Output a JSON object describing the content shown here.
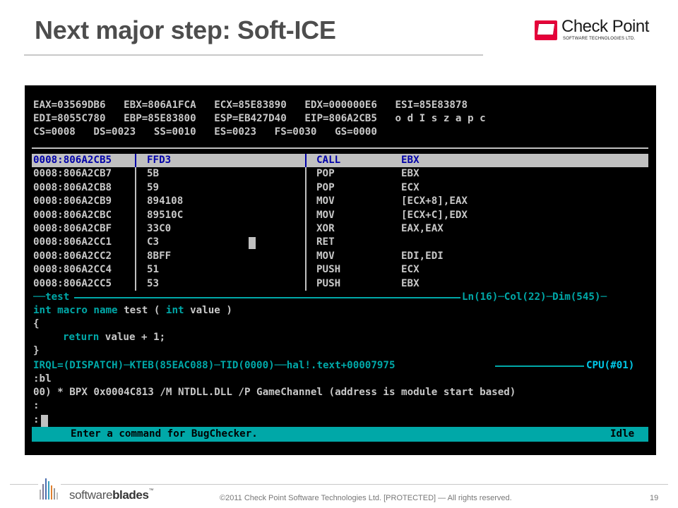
{
  "slide": {
    "title": "Next major step: Soft-ICE",
    "logo_main": "Check Point",
    "logo_sub": "SOFTWARE TECHNOLOGIES LTD.",
    "logo_badge": "CP"
  },
  "softice": {
    "registers": [
      "EAX=03569DB6   EBX=806A1FCA   ECX=85E83890   EDX=000000E6   ESI=85E83878",
      "EDI=8055C780   EBP=85E83800   ESP=EB427D40   EIP=806A2CB5   o d I s z a p c",
      "CS=0008   DS=0023   SS=0010   ES=0023   FS=0030   GS=0000"
    ],
    "code": [
      {
        "addr": "0008:806A2CB5",
        "bytes": "FFD3",
        "mnemonic": "CALL",
        "operand": "EBX"
      },
      {
        "addr": "0008:806A2CB7",
        "bytes": "5B",
        "mnemonic": "POP",
        "operand": "EBX"
      },
      {
        "addr": "0008:806A2CB8",
        "bytes": "59",
        "mnemonic": "POP",
        "operand": "ECX"
      },
      {
        "addr": "0008:806A2CB9",
        "bytes": "894108",
        "mnemonic": "MOV",
        "operand": "[ECX+8],EAX"
      },
      {
        "addr": "0008:806A2CBC",
        "bytes": "89510C",
        "mnemonic": "MOV",
        "operand": "[ECX+C],EDX"
      },
      {
        "addr": "0008:806A2CBF",
        "bytes": "33C0",
        "mnemonic": "XOR",
        "operand": "EAX,EAX"
      },
      {
        "addr": "0008:806A2CC1",
        "bytes": "C3",
        "mnemonic": "RET",
        "operand": ""
      },
      {
        "addr": "0008:806A2CC2",
        "bytes": "8BFF",
        "mnemonic": "MOV",
        "operand": "EDI,EDI"
      },
      {
        "addr": "0008:806A2CC4",
        "bytes": "51",
        "mnemonic": "PUSH",
        "operand": "ECX"
      },
      {
        "addr": "0008:806A2CC5",
        "bytes": "53",
        "mnemonic": "PUSH",
        "operand": "EBX"
      }
    ],
    "macro_header_left": "──test",
    "macro_header_right": "Ln(16)─Col(22)─Dim(545)─",
    "macro_sig": {
      "t1": "int",
      "t2": " macro name ",
      "t3": "test ( ",
      "t4": "int",
      "t5": " value )"
    },
    "macro_open": "{",
    "macro_ret_kw": "return",
    "macro_ret_rest": " value + 1;",
    "macro_close": "}",
    "irql_left": "IRQL=(DISPATCH)─KTEB(85EAC088)─TID(0000)──hal!.text+00007975",
    "irql_right": "CPU(#01)",
    "cmd_lines": [
      ":bl",
      "00) * BPX 0x0004C813 /M NTDLL.DLL /P GameChannel (address is module start based)",
      ":",
      ":"
    ],
    "status_left": "Enter a command for BugChecker.",
    "status_right": "Idle"
  },
  "footer": {
    "brand_light": "software",
    "brand_bold": "blades",
    "brand_tm": "™",
    "copyright": "©2011 Check Point Software Technologies Ltd.    [PROTECTED] — All rights reserved.",
    "page_number": "19"
  },
  "colors": {
    "terminal_bg": "#000000",
    "terminal_text": "#c0c0c0",
    "accent_cyan": "#00a8a8",
    "highlight_blue": "#0000a8",
    "brand_red": "#e60039"
  }
}
